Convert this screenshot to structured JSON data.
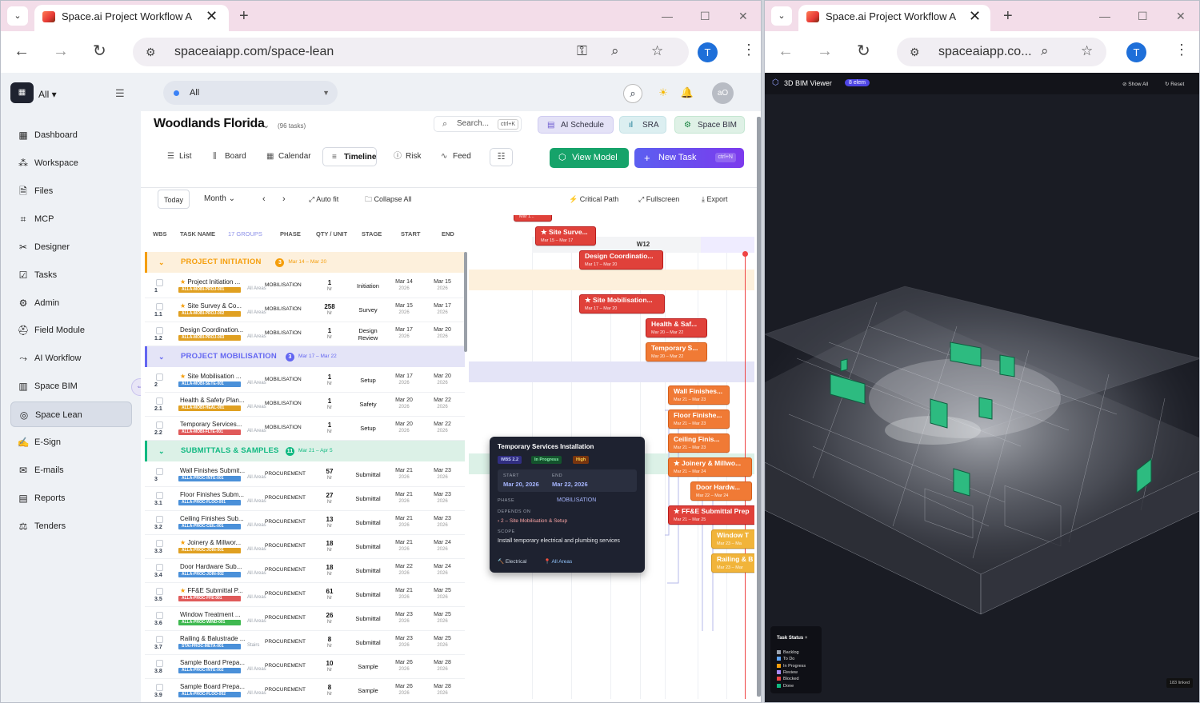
{
  "browser": {
    "tab_title": "Space.ai Project Workflow A",
    "url_full": "spaceaiapp.com/space-lean",
    "url_short": "spaceaiapp.co...",
    "avatar": "T"
  },
  "sidebar": {
    "workspace": "All",
    "items": [
      {
        "label": "Dashboard",
        "icon": "dashboard-icon",
        "glyph": "▦"
      },
      {
        "label": "Workspace",
        "icon": "workspace-icon",
        "glyph": "⁂"
      },
      {
        "label": "Files",
        "icon": "file-icon",
        "glyph": "🗎"
      },
      {
        "label": "MCP",
        "icon": "mcp-icon",
        "glyph": "⌗"
      },
      {
        "label": "Designer",
        "icon": "designer-icon",
        "glyph": "✂"
      },
      {
        "label": "Tasks",
        "icon": "tasks-icon",
        "glyph": "☑"
      },
      {
        "label": "Admin",
        "icon": "admin-icon",
        "glyph": "⚙"
      },
      {
        "label": "Field Module",
        "icon": "field-module-icon",
        "glyph": "⛑"
      },
      {
        "label": "AI Workflow",
        "icon": "ai-workflow-icon",
        "glyph": "⤳"
      },
      {
        "label": "Space BIM",
        "icon": "space-bim-icon",
        "glyph": "▥"
      },
      {
        "label": "Space Lean",
        "icon": "space-lean-icon",
        "glyph": "◎"
      },
      {
        "label": "E-Sign",
        "icon": "esign-icon",
        "glyph": "✍"
      },
      {
        "label": "E-mails",
        "icon": "email-icon",
        "glyph": "✉"
      },
      {
        "label": "Reports",
        "icon": "reports-icon",
        "glyph": "▤"
      },
      {
        "label": "Tenders",
        "icon": "tenders-icon",
        "glyph": "⚖"
      }
    ],
    "active_index": 10
  },
  "topbar": {
    "project_filter": "All",
    "user_initials": "aO"
  },
  "header": {
    "title": "Woodlands Florida",
    "task_count": "(96 tasks)",
    "search_placeholder": "Search...",
    "search_shortcut": "ctrl+K",
    "ai_schedule": "AI Schedule",
    "sra": "SRA",
    "space_bim": "Space BIM",
    "views": [
      "List",
      "Board",
      "Calendar",
      "Timeline",
      "Risk",
      "Feed"
    ],
    "active_view": "Timeline",
    "view_model": "View Model",
    "new_task": "New Task",
    "new_task_shortcut": "ctrl+N"
  },
  "timeline_toolbar": {
    "today": "Today",
    "scale": "Month",
    "auto_fit": "Auto fit",
    "collapse_all": "Collapse All",
    "critical_path": "Critical Path",
    "fullscreen": "Fullscreen",
    "export": "Export"
  },
  "table_headers": {
    "wbs": "WBS",
    "task_name": "TASK NAME",
    "groups": "17 GROUPS",
    "phase": "PHASE",
    "qty": "QTY / UNIT",
    "stage": "STAGE",
    "start": "START",
    "end": "END"
  },
  "groups": [
    {
      "name": "PROJECT INITIATION",
      "count": "3",
      "dates": "Mar 14 – Mar 20",
      "color": "#f59e0b",
      "bg": "#fdf0dc"
    },
    {
      "name": "PROJECT MOBILISATION",
      "count": "3",
      "dates": "Mar 17 – Mar 22",
      "color": "#6366f1",
      "bg": "#e4e4f7"
    },
    {
      "name": "SUBMITTALS & SAMPLES",
      "count": "11",
      "dates": "Mar 21 – Apr 5",
      "color": "#10b981",
      "bg": "#dcf1e7"
    }
  ],
  "tasks": [
    {
      "wbs": "1",
      "name": "Project Initiation ...",
      "star": true,
      "code": "ALLA-MOBI-PROJ-001",
      "code_color": "#e0a021",
      "areas": "All Areas",
      "phase": "MOBILISATION",
      "qty": "1",
      "unit": "Nr",
      "stage": "Initiation",
      "start": "Mar 14",
      "end": "Mar 15",
      "year": "2026"
    },
    {
      "wbs": "1.1",
      "name": "Site Survey & Co...",
      "star": true,
      "code": "ALLA-MOBI-PROJ-002",
      "code_color": "#e0a021",
      "areas": "All Areas",
      "phase": "MOBILISATION",
      "qty": "258",
      "unit": "Nr",
      "stage": "Survey",
      "start": "Mar 15",
      "end": "Mar 17",
      "year": "2026"
    },
    {
      "wbs": "1.2",
      "name": "Design Coordination...",
      "star": false,
      "code": "ALLA-MOBI-PROJ-003",
      "code_color": "#e0a021",
      "areas": "All Areas",
      "phase": "MOBILISATION",
      "qty": "1",
      "unit": "Nr",
      "stage": "Design Review",
      "start": "Mar 17",
      "end": "Mar 20",
      "year": "2026"
    },
    {
      "wbs": "2",
      "name": "Site Mobilisation ...",
      "star": true,
      "code": "ALLA-MOBI-SETE-001",
      "code_color": "#4a90d9",
      "areas": "All Areas",
      "phase": "MOBILISATION",
      "qty": "1",
      "unit": "Nr",
      "stage": "Setup",
      "start": "Mar 17",
      "end": "Mar 20",
      "year": "2026"
    },
    {
      "wbs": "2.1",
      "name": "Health & Safety Plan...",
      "star": false,
      "code": "ALLA-MOBI-HEAL-001",
      "code_color": "#e0a021",
      "areas": "All Areas",
      "phase": "MOBILISATION",
      "qty": "1",
      "unit": "Nr",
      "stage": "Safety",
      "start": "Mar 20",
      "end": "Mar 22",
      "year": "2026"
    },
    {
      "wbs": "2.2",
      "name": "Temporary Services...",
      "star": false,
      "code": "ALLA-MOBI-FLTE-001",
      "code_color": "#e05a5a",
      "areas": "All Areas",
      "phase": "MOBILISATION",
      "qty": "1",
      "unit": "Nr",
      "stage": "Setup",
      "start": "Mar 20",
      "end": "Mar 22",
      "year": "2026"
    },
    {
      "wbs": "3",
      "name": "Wall Finishes Submit...",
      "star": false,
      "code": "ALLA-PROC-INTE-001",
      "code_color": "#4a90d9",
      "areas": "All Areas",
      "phase": "PROCUREMENT",
      "qty": "57",
      "unit": "Nr",
      "stage": "Submittal",
      "start": "Mar 21",
      "end": "Mar 23",
      "year": "2026"
    },
    {
      "wbs": "3.1",
      "name": "Floor Finishes Subm...",
      "star": false,
      "code": "ALLA-PROC-FLOO-001",
      "code_color": "#4a90d9",
      "areas": "All Areas",
      "phase": "PROCUREMENT",
      "qty": "27",
      "unit": "Nr",
      "stage": "Submittal",
      "start": "Mar 21",
      "end": "Mar 23",
      "year": "2026"
    },
    {
      "wbs": "3.2",
      "name": "Ceiling Finishes Sub...",
      "star": false,
      "code": "ALLA-PROC-CEIL-001",
      "code_color": "#4a90d9",
      "areas": "All Areas",
      "phase": "PROCUREMENT",
      "qty": "13",
      "unit": "Nr",
      "stage": "Submittal",
      "start": "Mar 21",
      "end": "Mar 23",
      "year": "2026"
    },
    {
      "wbs": "3.3",
      "name": "Joinery & Millwor...",
      "star": true,
      "code": "ALLA-PROC-JOIN-001",
      "code_color": "#e0a021",
      "areas": "All Areas",
      "phase": "PROCUREMENT",
      "qty": "18",
      "unit": "Nr",
      "stage": "Submittal",
      "start": "Mar 21",
      "end": "Mar 24",
      "year": "2026"
    },
    {
      "wbs": "3.4",
      "name": "Door Hardware Sub...",
      "star": false,
      "code": "ALLA-PROC-JOIN-002",
      "code_color": "#4a90d9",
      "areas": "All Areas",
      "phase": "PROCUREMENT",
      "qty": "18",
      "unit": "Nr",
      "stage": "Submittal",
      "start": "Mar 22",
      "end": "Mar 24",
      "year": "2026"
    },
    {
      "wbs": "3.5",
      "name": "FF&E Submittal P...",
      "star": true,
      "code": "ALLA-PROC-FFE-001",
      "code_color": "#e05a5a",
      "areas": "All Areas",
      "phase": "PROCUREMENT",
      "qty": "61",
      "unit": "Nr",
      "stage": "Submittal",
      "start": "Mar 21",
      "end": "Mar 25",
      "year": "2026"
    },
    {
      "wbs": "3.6",
      "name": "Window Treatment ...",
      "star": false,
      "code": "ALLA-PROC-WIND-001",
      "code_color": "#3fb950",
      "areas": "All Areas",
      "phase": "PROCUREMENT",
      "qty": "26",
      "unit": "Nr",
      "stage": "Submittal",
      "start": "Mar 23",
      "end": "Mar 25",
      "year": "2026"
    },
    {
      "wbs": "3.7",
      "name": "Railing & Balustrade ...",
      "star": false,
      "code": "STAI-PROC-META-001",
      "code_color": "#4a90d9",
      "areas": "Stairs",
      "phase": "PROCUREMENT",
      "qty": "8",
      "unit": "Nr",
      "stage": "Submittal",
      "start": "Mar 23",
      "end": "Mar 25",
      "year": "2026"
    },
    {
      "wbs": "3.8",
      "name": "Sample Board Prepa...",
      "star": false,
      "code": "ALLA-PROC-INTE-002",
      "code_color": "#4a90d9",
      "areas": "All Areas",
      "phase": "PROCUREMENT",
      "qty": "10",
      "unit": "Nr",
      "stage": "Sample",
      "start": "Mar 26",
      "end": "Mar 28",
      "year": "2026"
    },
    {
      "wbs": "3.9",
      "name": "Sample Board Prepa...",
      "star": false,
      "code": "ALLA-PROC-FLOO-002",
      "code_color": "#4a90d9",
      "areas": "All Areas",
      "phase": "PROCUREMENT",
      "qty": "8",
      "unit": "Nr",
      "stage": "Sample",
      "start": "Mar 26",
      "end": "Mar 28",
      "year": "2026"
    }
  ],
  "gantt": {
    "week_label": "W12",
    "bars": [
      {
        "label": "Pro...",
        "dates": "Mar 1...",
        "color": "red",
        "star": true
      },
      {
        "label": "Site Surve...",
        "dates": "Mar 15 – Mar 17",
        "color": "red",
        "star": true
      },
      {
        "label": "Design Coordinatio...",
        "dates": "Mar 17 – Mar 20",
        "color": "red",
        "star": false
      },
      {
        "label": "Site Mobilisation...",
        "dates": "Mar 17 – Mar 20",
        "color": "red",
        "star": true
      },
      {
        "label": "Health & Saf...",
        "dates": "Mar 20 – Mar 22",
        "color": "red",
        "star": false
      },
      {
        "label": "Temporary S...",
        "dates": "Mar 20 – Mar 22",
        "color": "orange",
        "star": false
      },
      {
        "label": "Wall Finishes...",
        "dates": "Mar 21 – Mar 23",
        "color": "orange",
        "star": false
      },
      {
        "label": "Floor Finishe...",
        "dates": "Mar 21 – Mar 23",
        "color": "orange",
        "star": false
      },
      {
        "label": "Ceiling Finis...",
        "dates": "Mar 21 – Mar 23",
        "color": "orange",
        "star": false
      },
      {
        "label": "Joinery & Millwo...",
        "dates": "Mar 21 – Mar 24",
        "color": "orange",
        "star": true
      },
      {
        "label": "Door Hardw...",
        "dates": "Mar 22 – Mar 24",
        "color": "orange",
        "star": false
      },
      {
        "label": "FF&E Submittal Prep",
        "dates": "Mar 21 – Mar 25",
        "color": "red",
        "star": true
      },
      {
        "label": "Window T",
        "dates": "Mar 23 – Ma",
        "color": "yellow",
        "star": false
      },
      {
        "label": "Railing & B",
        "dates": "Mar 23 – Mar",
        "color": "yellow",
        "star": false
      }
    ]
  },
  "tooltip": {
    "title": "Temporary Services Installation",
    "wbs": "WBS 2.2",
    "status": "In Progress",
    "priority": "High",
    "start_label": "START",
    "start": "Mar 20, 2026",
    "end_label": "END",
    "end": "Mar 22, 2026",
    "phase_label": "PHASE",
    "phase": "MOBILISATION",
    "depends_label": "DEPENDS ON",
    "depends": "2 – Site Mobilisation & Setup",
    "scope_label": "SCOPE",
    "scope": "Install temporary electrical and plumbing services",
    "trade": "Electrical",
    "location": "All Areas"
  },
  "bim": {
    "title": "3D BIM Viewer",
    "badge": "8 elem",
    "show_all": "Show All",
    "reset": "Reset",
    "legend_title": "Task Status",
    "legend": [
      {
        "label": "Backlog",
        "color": "#9ca3af"
      },
      {
        "label": "To Do",
        "color": "#60a5fa"
      },
      {
        "label": "In Progress",
        "color": "#f59e0b"
      },
      {
        "label": "Review",
        "color": "#a78bfa"
      },
      {
        "label": "Blocked",
        "color": "#ef4444"
      },
      {
        "label": "Done",
        "color": "#10b981"
      }
    ],
    "linked": "183 linked"
  }
}
